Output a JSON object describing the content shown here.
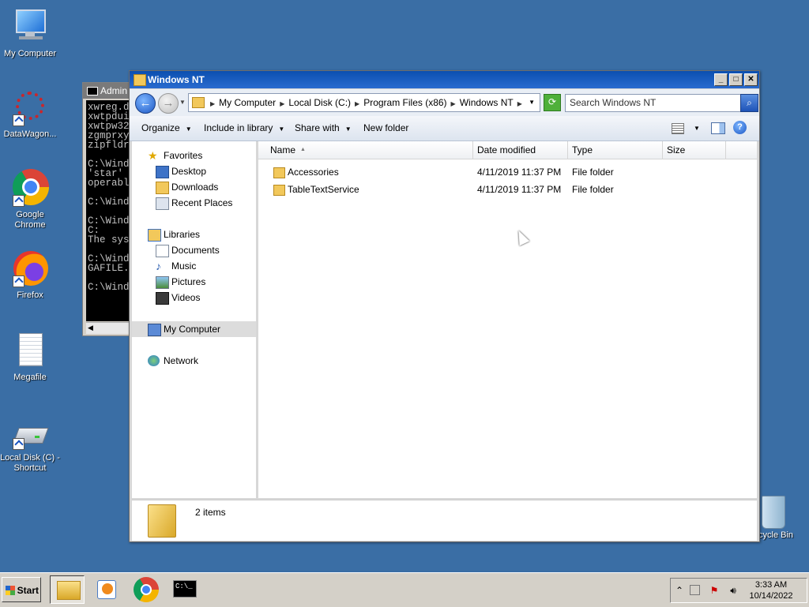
{
  "desktop": {
    "icons": [
      {
        "label": "My Computer",
        "icon": "computer-icon"
      },
      {
        "label": "DataWagon...",
        "icon": "datawagon-icon"
      },
      {
        "label": "Google Chrome",
        "icon": "chrome-icon"
      },
      {
        "label": "Firefox",
        "icon": "firefox-icon"
      },
      {
        "label": "Megafile",
        "icon": "document-icon"
      },
      {
        "label": "Local Disk (C) - Shortcut",
        "icon": "drive-icon"
      },
      {
        "label": "cycle Bin",
        "icon": "recycle-bin-icon"
      }
    ]
  },
  "console": {
    "title": "Admin",
    "lines": "xwreg.d\nxwtpdui\nxwtpw32\nzgmprxy\nzipfldr\n\nC:\\Wind\n'star'\noperabl\n\nC:\\Wind\n\nC:\\Wind\nC:\nThe sys\n\nC:\\Wind\nGAFILE.\n\nC:\\Wind"
  },
  "explorer": {
    "title": "Windows NT",
    "breadcrumbs": [
      "My Computer",
      "Local Disk (C:)",
      "Program Files (x86)",
      "Windows NT"
    ],
    "search_placeholder": "Search Windows NT",
    "commands": {
      "organize": "Organize",
      "include": "Include in library",
      "share": "Share with",
      "newfolder": "New folder"
    },
    "nav": {
      "favorites": "Favorites",
      "desktop": "Desktop",
      "downloads": "Downloads",
      "recent": "Recent Places",
      "libraries": "Libraries",
      "documents": "Documents",
      "music": "Music",
      "pictures": "Pictures",
      "videos": "Videos",
      "mycomputer": "My Computer",
      "network": "Network"
    },
    "columns": {
      "name": "Name",
      "date": "Date modified",
      "type": "Type",
      "size": "Size"
    },
    "files": [
      {
        "name": "Accessories",
        "date": "4/11/2019 11:37 PM",
        "type": "File folder",
        "size": ""
      },
      {
        "name": "TableTextService",
        "date": "4/11/2019 11:37 PM",
        "type": "File folder",
        "size": ""
      }
    ],
    "status": "2 items"
  },
  "taskbar": {
    "start": "Start",
    "time": "3:33 AM",
    "date": "10/14/2022"
  },
  "colors": {
    "desktop": "#3a6ea5",
    "titlebar": "#0b4fb0"
  }
}
